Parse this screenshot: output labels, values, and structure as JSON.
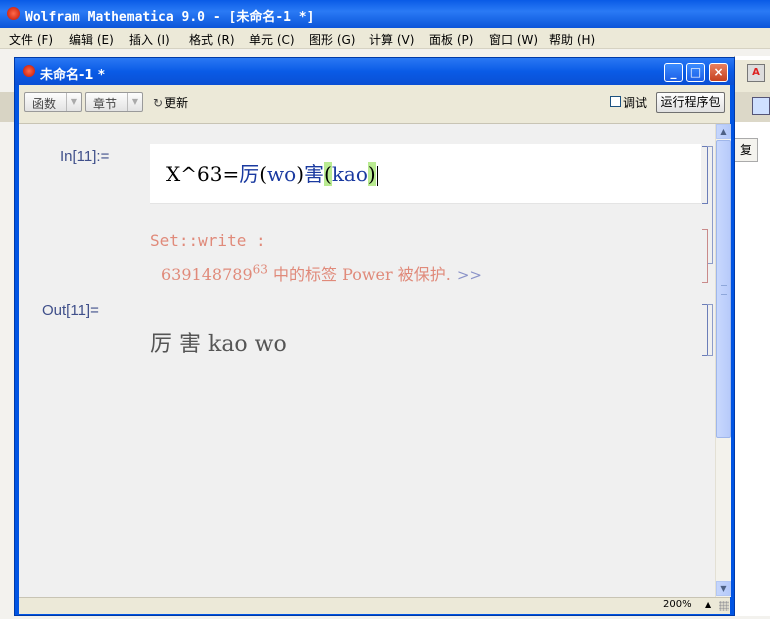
{
  "app": {
    "title": "Wolfram Mathematica 9.0 - [未命名-1 *]"
  },
  "menubar": {
    "items": [
      "文件 (F)",
      "编辑 (E)",
      "插入 (I)",
      "格式 (R)",
      "单元 (C)",
      "图形 (G)",
      "计算 (V)",
      "面板 (P)",
      "窗口 (W)",
      "帮助 (H)"
    ]
  },
  "background": {
    "side_button": "复"
  },
  "notebook": {
    "title": "未命名-1 *",
    "toolbar": {
      "functions_label": "函数",
      "section_label": "章节",
      "refresh_label": "更新",
      "debug_label": "调试",
      "run_package_label": "运行程序包"
    },
    "input_label": "In[11]:=",
    "input": {
      "prefix": "X^63=",
      "sym1": "厉",
      "open1": "(",
      "arg1": "wo",
      "close1": ")",
      "sym2": "害",
      "open2": "(",
      "arg2": "kao",
      "close2": ")"
    },
    "message": {
      "line1": "Set::write :",
      "base": "639148789",
      "exponent": "63",
      "rest": " 中的标签 Power 被保护.",
      "more": ">>"
    },
    "output_label": "Out[11]=",
    "output": "厉 害 kao wo",
    "status": {
      "zoom": "200%"
    }
  }
}
